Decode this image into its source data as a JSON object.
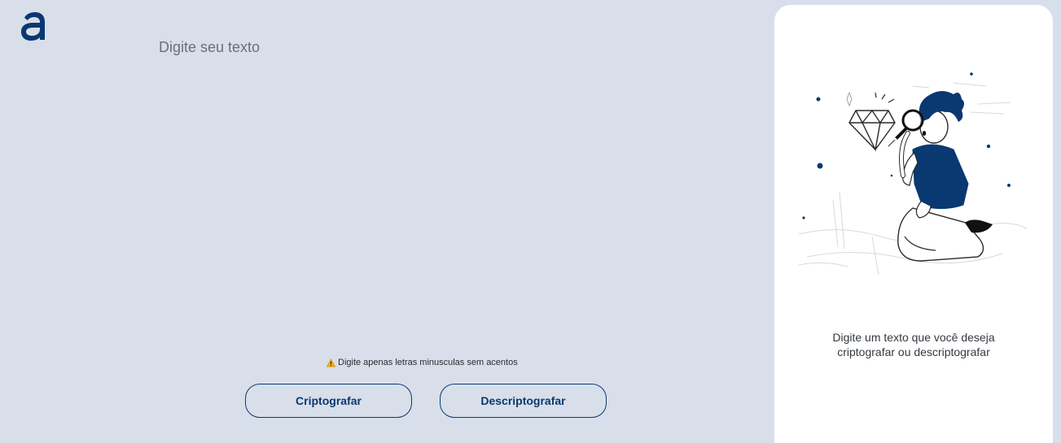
{
  "app": {
    "logo_name": "alura-logo",
    "brand_color": "#0a3871",
    "background_color": "#d8dfea"
  },
  "editor": {
    "value": "",
    "placeholder": "Digite seu texto"
  },
  "warning": {
    "icon": "warning-icon",
    "text": "Digite apenas letras minusculas sem acentos"
  },
  "buttons": {
    "encrypt_label": "Criptografar",
    "decrypt_label": "Descriptografar"
  },
  "output_panel": {
    "illustration": "person-with-magnifying-glass-and-diamond",
    "message_line1": "Digite um texto que você deseja",
    "message_line2": "criptografar ou descriptografar"
  }
}
